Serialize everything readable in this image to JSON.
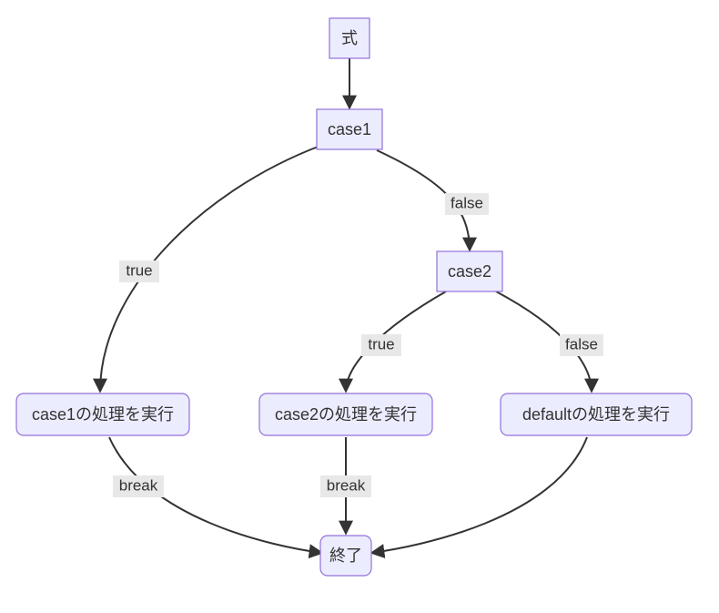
{
  "diagram": {
    "type": "flowchart",
    "nodes": {
      "expr": {
        "label": "式"
      },
      "case1": {
        "label": "case1"
      },
      "case2": {
        "label": "case2"
      },
      "proc1": {
        "label": "case1の処理を実行"
      },
      "proc2": {
        "label": "case2の処理を実行"
      },
      "procD": {
        "label": "defaultの処理を実行"
      },
      "end": {
        "label": "終了"
      }
    },
    "edges": {
      "expr_case1": {
        "from": "expr",
        "to": "case1",
        "label": ""
      },
      "case1_proc1": {
        "from": "case1",
        "to": "proc1",
        "label": "true"
      },
      "case1_case2": {
        "from": "case1",
        "to": "case2",
        "label": "false"
      },
      "case2_proc2": {
        "from": "case2",
        "to": "proc2",
        "label": "true"
      },
      "case2_procD": {
        "from": "case2",
        "to": "procD",
        "label": "false"
      },
      "proc1_end": {
        "from": "proc1",
        "to": "end",
        "label": "break"
      },
      "proc2_end": {
        "from": "proc2",
        "to": "end",
        "label": "break"
      },
      "procD_end": {
        "from": "procD",
        "to": "end",
        "label": ""
      }
    }
  }
}
